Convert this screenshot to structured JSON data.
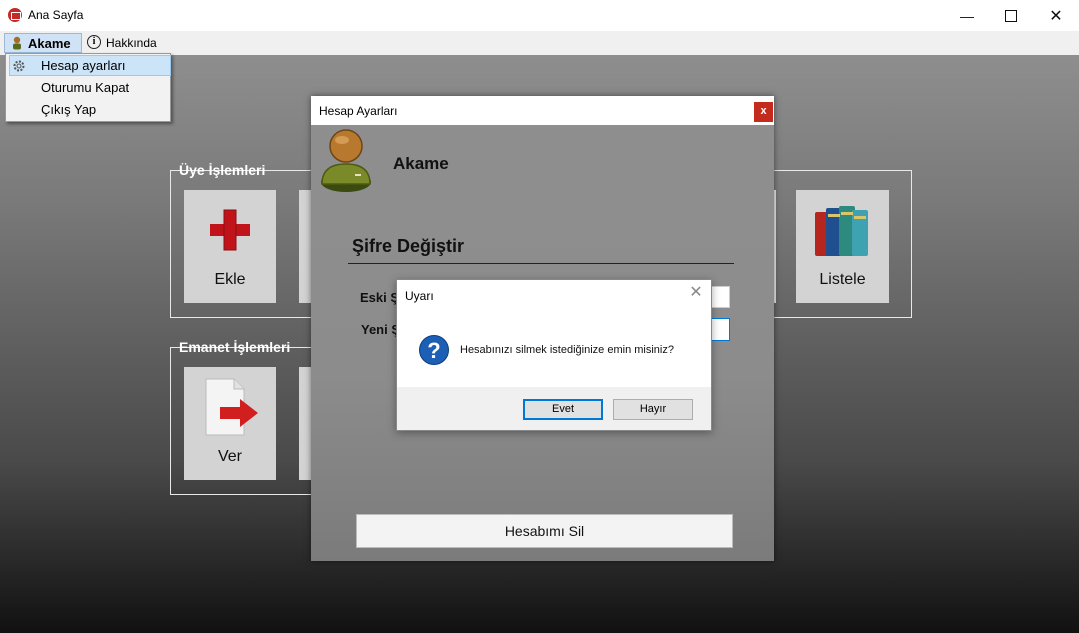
{
  "window": {
    "title": "Ana Sayfa",
    "controls": [
      "minimize",
      "maximize",
      "close"
    ]
  },
  "menubar": {
    "user_menu_label": "Akame",
    "about_label": "Hakkında"
  },
  "dropdown": {
    "items": [
      {
        "label": "Hesap ayarları",
        "icon": "gear-icon",
        "highlighted": true
      },
      {
        "label": "Oturumu Kapat"
      },
      {
        "label": "Çıkış Yap"
      }
    ]
  },
  "main": {
    "member_group": {
      "label": "Üye İşlemleri",
      "tiles": [
        {
          "label": "Ekle",
          "icon": "plus-icon"
        },
        {
          "label": "Listele",
          "icon": "books-icon"
        }
      ]
    },
    "loan_group": {
      "label": "Emanet İşlemleri",
      "tiles": [
        {
          "label": "Ver",
          "icon": "document-arrow-icon"
        }
      ]
    }
  },
  "account_dialog": {
    "title": "Hesap Ayarları",
    "close_label": "x",
    "username": "Akame",
    "password_heading": "Şifre Değiştir",
    "old_password_label": "Eski Ş",
    "new_password_label": "Yeni Ş",
    "delete_button": "Hesabımı Sil"
  },
  "message_box": {
    "title": "Uyarı",
    "message": "Hesabınızı silmek istediğinize emin misiniz?",
    "icon": "question-icon",
    "yes_label": "Evet",
    "no_label": "Hayır"
  },
  "colors": {
    "close_red": "#c42b1c",
    "menu_highlight": "#cce4f7",
    "question_blue": "#1c5fb5",
    "plus_red": "#c0141a"
  }
}
